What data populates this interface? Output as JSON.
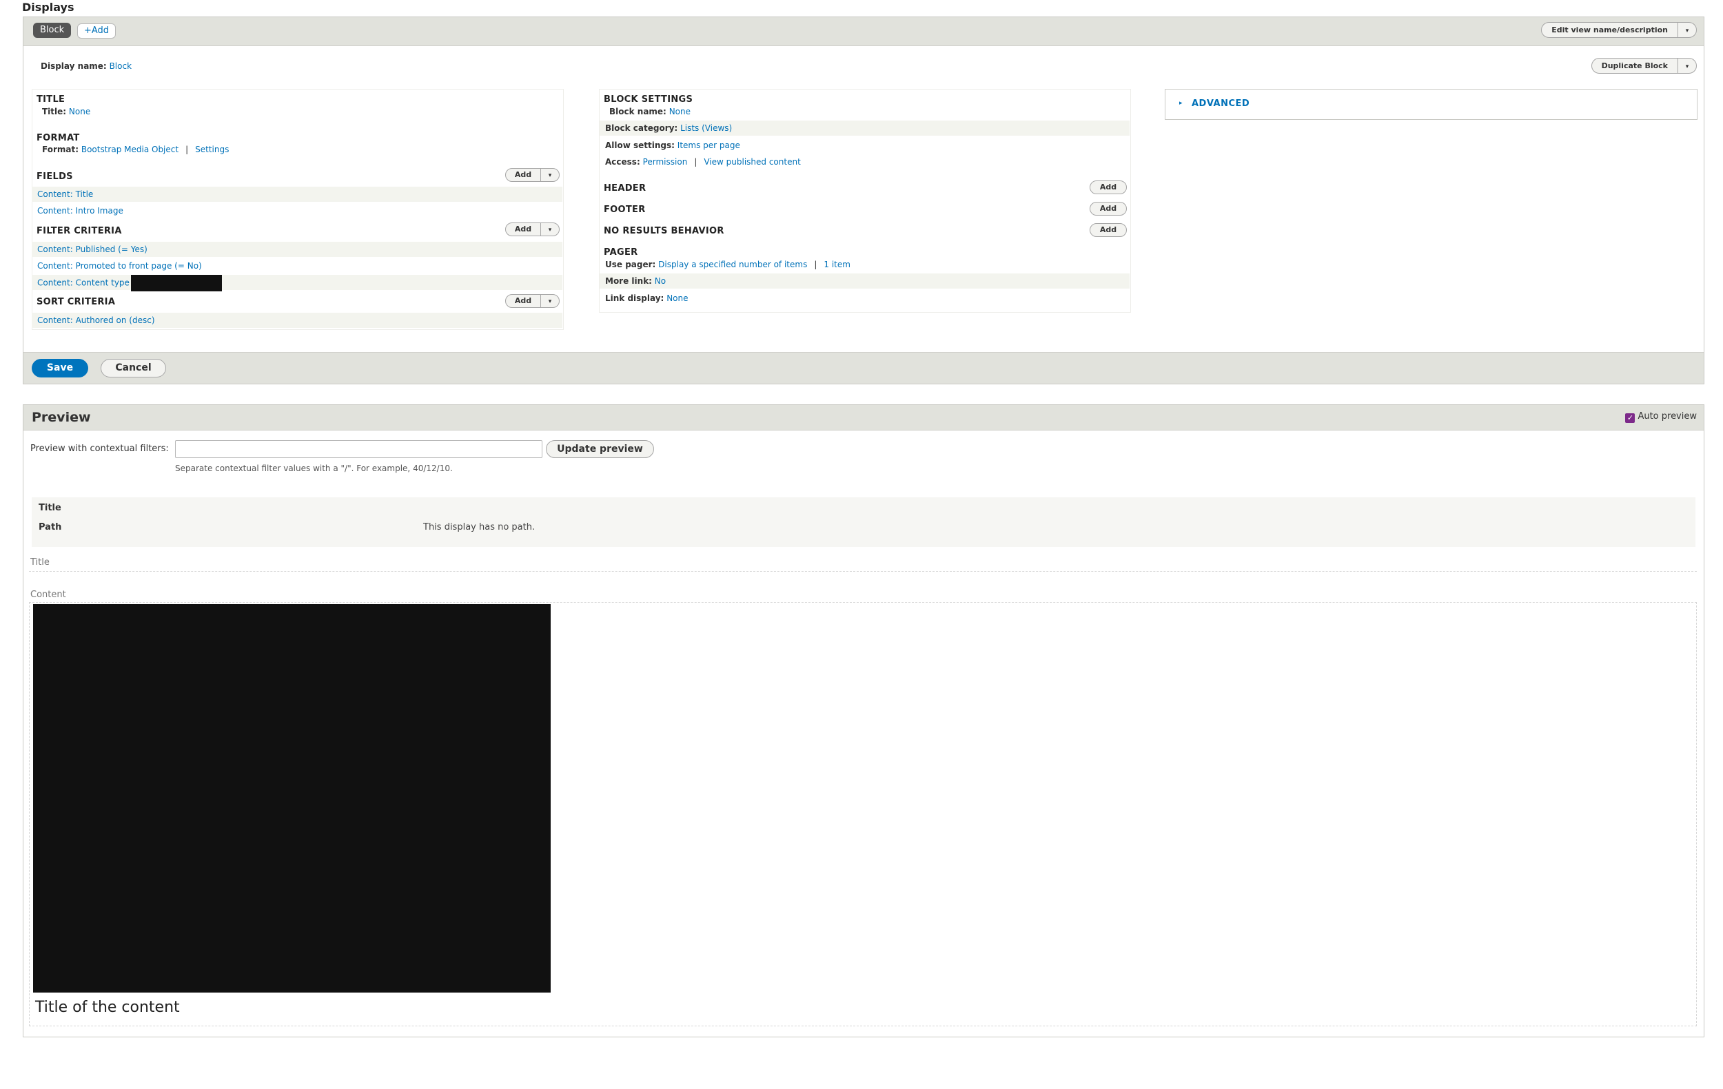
{
  "page": {
    "heading": "Displays"
  },
  "tabs": {
    "block": "Block",
    "add": "+Add"
  },
  "toolbar": {
    "edit_view": "Edit view name/description",
    "duplicate": "Duplicate Block",
    "arrow": "▾"
  },
  "display_name": {
    "label": "Display name:",
    "value": "Block"
  },
  "left": {
    "title_h": "TITLE",
    "title_row": {
      "label": "Title:",
      "value": "None"
    },
    "format_h": "FORMAT",
    "format_row": {
      "label": "Format:",
      "value": "Bootstrap Media Object",
      "sep": "|",
      "settings": "Settings"
    },
    "fields_h": "FIELDS",
    "fields": [
      "Content: Title",
      "Content: Intro Image"
    ],
    "filter_h": "FILTER CRITERIA",
    "filters": [
      "Content: Published (= Yes)",
      "Content: Promoted to front page (= No)",
      "Content: Content type"
    ],
    "sort_h": "SORT CRITERIA",
    "sorts": [
      "Content: Authored on (desc)"
    ],
    "add": "Add"
  },
  "middle": {
    "block_h": "BLOCK SETTINGS",
    "block_name": {
      "label": "Block name:",
      "value": "None"
    },
    "block_category": {
      "label": "Block category:",
      "value": "Lists (Views)"
    },
    "allow_settings": {
      "label": "Allow settings:",
      "value": "Items per page"
    },
    "access": {
      "label": "Access:",
      "value": "Permission",
      "sep": "|",
      "value2": "View published content"
    },
    "header_h": "HEADER",
    "footer_h": "FOOTER",
    "nores_h": "NO RESULTS BEHAVIOR",
    "pager_h": "PAGER",
    "use_pager": {
      "label": "Use pager:",
      "value": "Display a specified number of items",
      "sep": "|",
      "value2": "1 item"
    },
    "more_link": {
      "label": "More link:",
      "value": "No"
    },
    "link_display": {
      "label": "Link display:",
      "value": "None"
    },
    "add": "Add"
  },
  "advanced": {
    "label": "ADVANCED",
    "caret": "▸"
  },
  "actions": {
    "save": "Save",
    "cancel": "Cancel"
  },
  "preview": {
    "title": "Preview",
    "auto_preview": "Auto preview",
    "auto_preview_checked": true,
    "ctx_label": "Preview with contextual filters:",
    "ctx_value": "",
    "update": "Update preview",
    "ctx_desc": "Separate contextual filter values with a \"/\". For example, 40/12/10.",
    "info": [
      {
        "key": "Title",
        "value": ""
      },
      {
        "key": "Path",
        "value": "This display has no path."
      }
    ],
    "title_label": "Title",
    "content_label": "Content",
    "content_title": "Title of the content"
  }
}
